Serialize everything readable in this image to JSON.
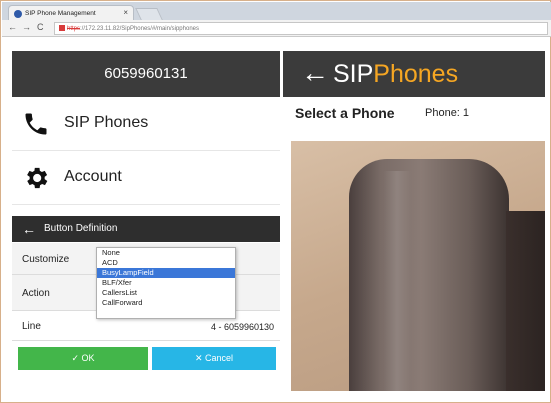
{
  "browser": {
    "tab_title": "SIP Phone Management",
    "tab_close": "×",
    "nav_back": "←",
    "nav_forward": "→",
    "nav_reload": "C",
    "url_scheme": "https",
    "url_rest": "://172.23.11.82/SipPhones/#/main/sipphones"
  },
  "app": {
    "user_number": "6059960131",
    "brand_part1": "SIP",
    "brand_part2": "Phones",
    "back_arrow": "←",
    "colors": {
      "header_bg": "#3b3b3b",
      "brand_accent": "#f5a623",
      "ok": "#43b64a",
      "cancel": "#27b6e6",
      "selected": "#3b77d8"
    }
  },
  "sidebar": {
    "items": [
      {
        "label": "SIP Phones",
        "icon": "phone-icon"
      },
      {
        "label": "Account",
        "icon": "gear-icon"
      }
    ]
  },
  "button_definition": {
    "title": "Button Definition",
    "back_arrow": "←",
    "rows": [
      {
        "label": "Customize"
      },
      {
        "label": "Action"
      },
      {
        "label": "Line",
        "value": "4 - 6059960130"
      }
    ],
    "dropdown_options": [
      "None",
      "ACD",
      "BusyLampField",
      "BLF/Xfer",
      "CallersList",
      "CallForward"
    ],
    "dropdown_selected": "BusyLampField",
    "ok_label": "✓ OK",
    "cancel_label": "✕ Cancel"
  },
  "main": {
    "title": "Select a Phone",
    "phone_label": "Phone: 1"
  }
}
